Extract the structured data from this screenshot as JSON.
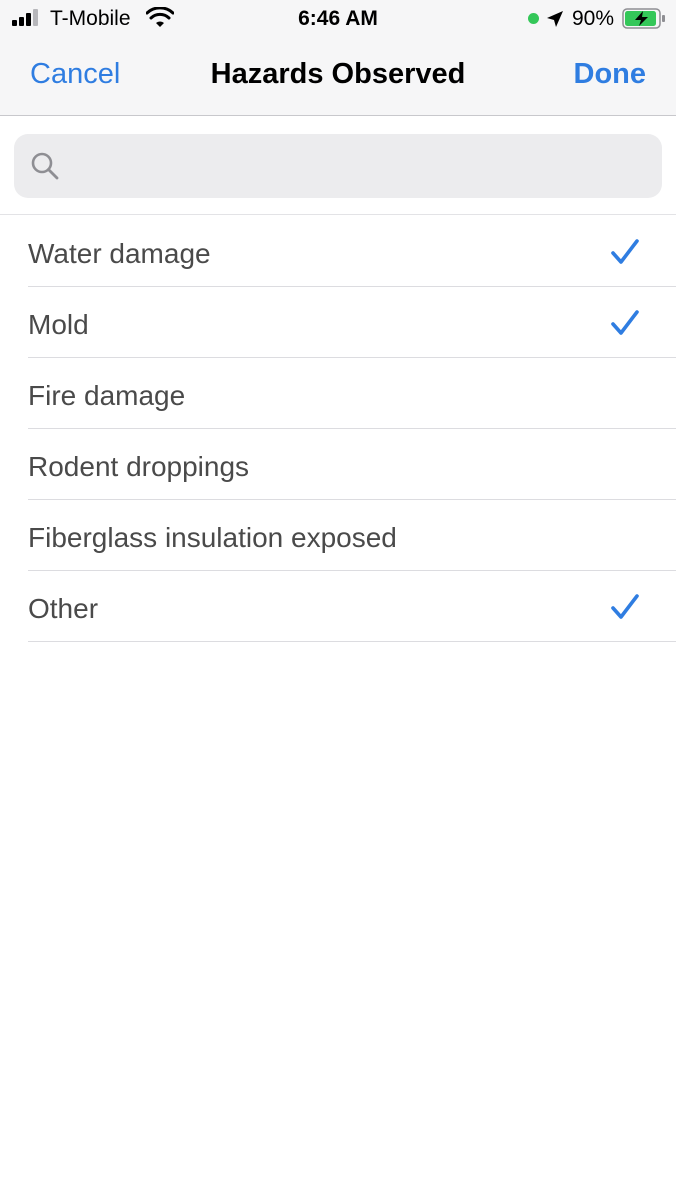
{
  "status_bar": {
    "carrier": "T-Mobile",
    "time": "6:46 AM",
    "battery_percent": "90%",
    "icons": [
      "signal-icon",
      "wifi-icon",
      "location-icon",
      "battery-charging-icon"
    ]
  },
  "nav": {
    "cancel_label": "Cancel",
    "title": "Hazards Observed",
    "done_label": "Done"
  },
  "search": {
    "value": "",
    "placeholder": "",
    "icon": "search-icon"
  },
  "colors": {
    "accent": "#2f7de1",
    "header_bg": "#f6f6f7",
    "search_bg": "#ececee",
    "row_text": "#4a4a4a",
    "separator": "#dcdce0"
  },
  "items": [
    {
      "label": "Water damage",
      "selected": true
    },
    {
      "label": "Mold",
      "selected": true
    },
    {
      "label": "Fire damage",
      "selected": false
    },
    {
      "label": "Rodent droppings",
      "selected": false
    },
    {
      "label": "Fiberglass insulation exposed",
      "selected": false
    },
    {
      "label": "Other",
      "selected": true
    }
  ]
}
